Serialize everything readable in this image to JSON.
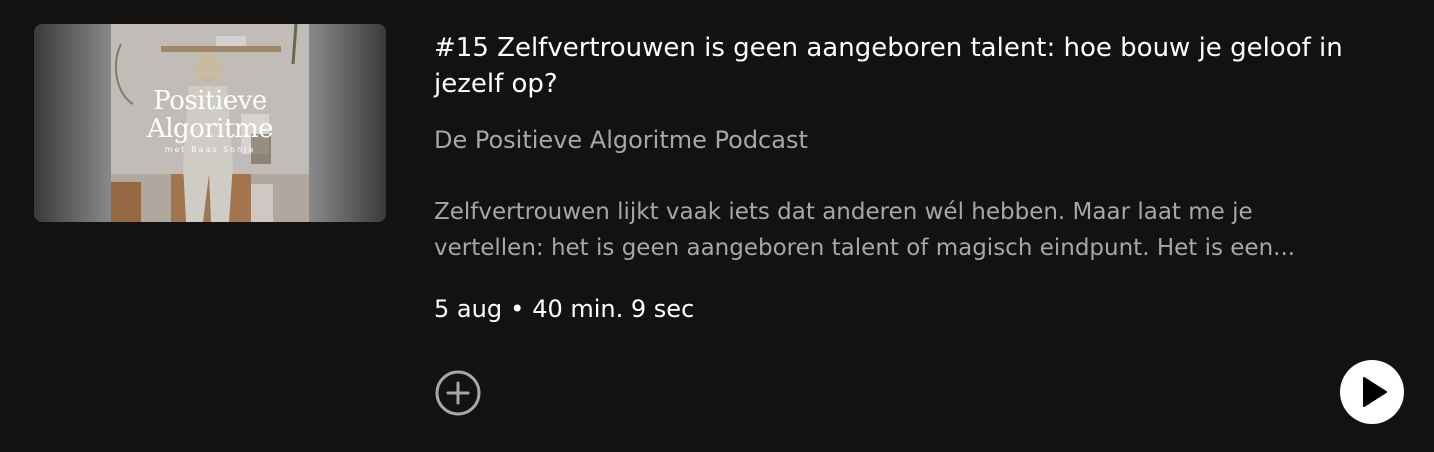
{
  "episode": {
    "title": "#15 Zelfvertrouwen is geen aangeboren talent: hoe bouw je geloof in jezelf op?",
    "show_name": "De Positieve Algoritme Podcast",
    "description": "Zelfvertrouwen lijkt vaak iets dat anderen wél hebben. Maar laat me je vertellen: het is geen aangeboren talent of magisch eindpunt. Het is een...",
    "date": "5 aug",
    "separator": "•",
    "duration": "40 min. 9 sec"
  },
  "cover": {
    "title_line1": "Positieve",
    "title_line2": "Algoritme",
    "subtitle": "met Baas Sonja"
  },
  "actions": {
    "add_icon": "plus-circle-icon",
    "play_icon": "play-icon"
  },
  "colors": {
    "background": "#121212",
    "primary_text": "#ffffff",
    "secondary_text": "#a7a7a7",
    "play_button": "#ffffff"
  }
}
